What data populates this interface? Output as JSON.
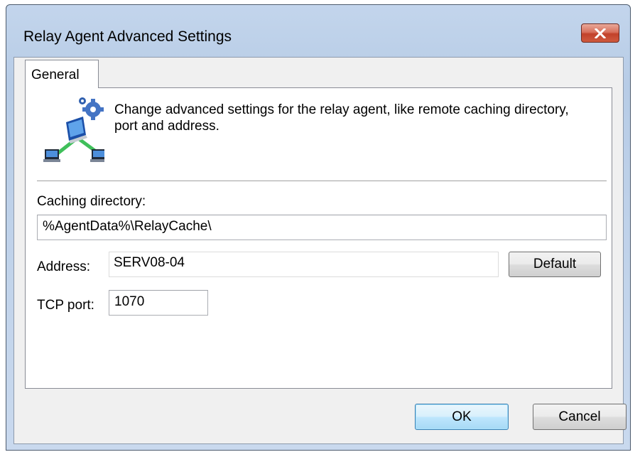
{
  "window": {
    "title": "Relay Agent Advanced Settings"
  },
  "tabs": [
    {
      "label": "General",
      "active": true
    }
  ],
  "general": {
    "icon": "relay-agent-network-icon",
    "description": "Change advanced settings for the relay agent, like remote caching directory, port and address.",
    "caching_directory": {
      "label": "Caching directory:",
      "value": "%AgentData%\\RelayCache\\"
    },
    "address": {
      "label": "Address:",
      "value": "SERV08-04"
    },
    "default_button": "Default",
    "tcp_port": {
      "label": "TCP port:",
      "value": "1070"
    }
  },
  "buttons": {
    "ok": "OK",
    "cancel": "Cancel"
  },
  "colors": {
    "close_button": "#c7432b",
    "frame": "#bed1e9",
    "dialog_bg": "#f0f0f0",
    "default_button_accent": "#3c7fb1"
  }
}
